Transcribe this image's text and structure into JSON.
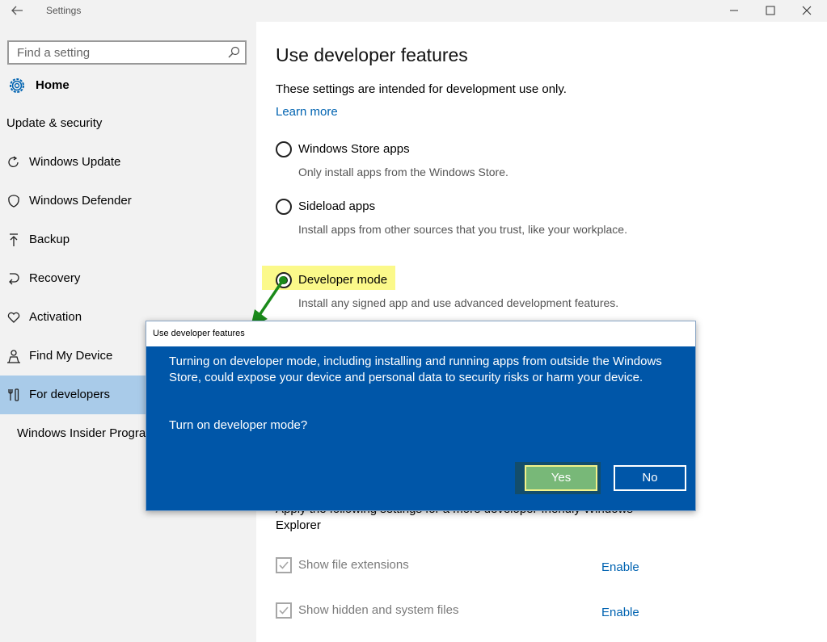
{
  "window": {
    "title": "Settings"
  },
  "sidebar": {
    "search_placeholder": "Find a setting",
    "home_label": "Home",
    "section_title": "Update & security",
    "items": [
      {
        "label": "Windows Update",
        "icon": "refresh-icon"
      },
      {
        "label": "Windows Defender",
        "icon": "shield-icon"
      },
      {
        "label": "Backup",
        "icon": "backup-arrow-icon"
      },
      {
        "label": "Recovery",
        "icon": "recovery-icon"
      },
      {
        "label": "Activation",
        "icon": "heart-check-icon"
      },
      {
        "label": "Find My Device",
        "icon": "person-locate-icon"
      },
      {
        "label": "For developers",
        "icon": "developer-tools-icon",
        "active": true
      },
      {
        "label": "Windows Insider Progra",
        "icon": null
      }
    ]
  },
  "content": {
    "heading": "Use developer features",
    "intro": "These settings are intended for development use only.",
    "learn_more": "Learn more",
    "options": [
      {
        "label": "Windows Store apps",
        "description": "Only install apps from the Windows Store.",
        "selected": false
      },
      {
        "label": "Sideload apps",
        "description": "Install apps from other sources that you trust, like your workplace.",
        "selected": false
      },
      {
        "label": "Developer mode",
        "description": "Install any signed app and use advanced development features.",
        "selected": true
      }
    ],
    "explorer_text": "Apply the following settings for a more developer-friendly Windows Explorer",
    "settings": [
      {
        "label": "Show file extensions",
        "action": "Enable",
        "checked": true
      },
      {
        "label": "Show hidden and system files",
        "action": "Enable",
        "checked": true
      }
    ]
  },
  "dialog": {
    "title": "Use developer features",
    "message": "Turning on developer mode, including installing and running apps from outside the Windows Store, could expose your device and personal data to security risks or harm your device.",
    "question": "Turn on developer mode?",
    "yes_label": "Yes",
    "no_label": "No"
  },
  "colors": {
    "accent": "#0063b1",
    "dialog_bg": "#0056a8",
    "active_nav": "#a9cbe9",
    "highlight": "#fbf98a",
    "annotation_arrow": "#1a8a1a"
  }
}
